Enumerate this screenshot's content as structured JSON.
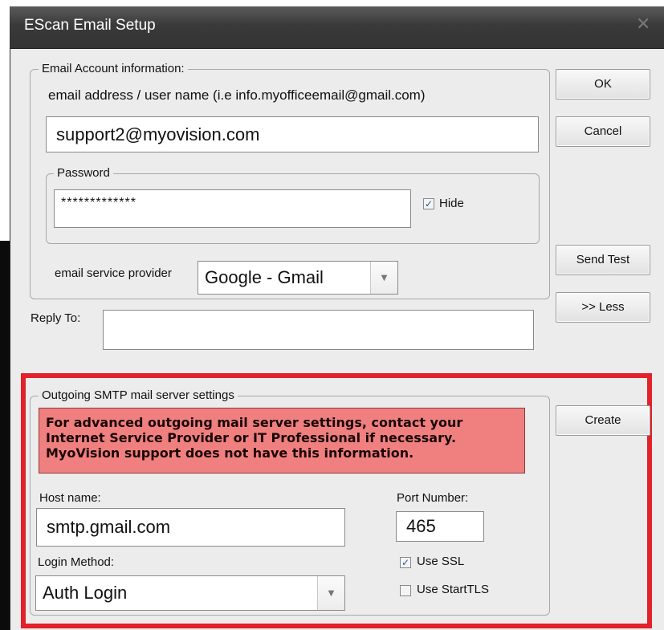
{
  "window": {
    "title": "EScan Email Setup",
    "close_icon": "close-icon"
  },
  "account_group": {
    "legend": "Email Account information:",
    "hint": "email address / user name (i.e info.myofficeemail@gmail.com)",
    "email_value": "support2@myovision.com",
    "password_group": {
      "legend": "Password",
      "password_value": "*************",
      "hide_label": "Hide",
      "hide_checked": true
    },
    "provider_label": "email service provider",
    "provider_value": "Google - Gmail"
  },
  "reply_to": {
    "label": "Reply To:",
    "value": ""
  },
  "buttons": {
    "ok": "OK",
    "cancel": "Cancel",
    "send_test": "Send Test",
    "less": ">> Less",
    "create": "Create"
  },
  "smtp_group": {
    "legend": "Outgoing SMTP mail server settings",
    "warning_lines": [
      "For advanced outgoing mail server settings, contact your",
      "Internet Service Provider or IT Professional if necessary.",
      "MyoVision support does not have this information."
    ],
    "host_label": "Host name:",
    "host_value": "smtp.gmail.com",
    "port_label": "Port Number:",
    "port_value": "465",
    "login_label": "Login Method:",
    "login_value": "Auth Login",
    "use_ssl_label": "Use SSL",
    "use_ssl_checked": true,
    "use_starttls_label": "Use StartTLS",
    "use_starttls_checked": false
  },
  "colors": {
    "highlight_frame": "#e2212a",
    "warning_bg": "#f08080",
    "titlebar": "#3a3a3a",
    "dialog_bg": "#ececec"
  }
}
